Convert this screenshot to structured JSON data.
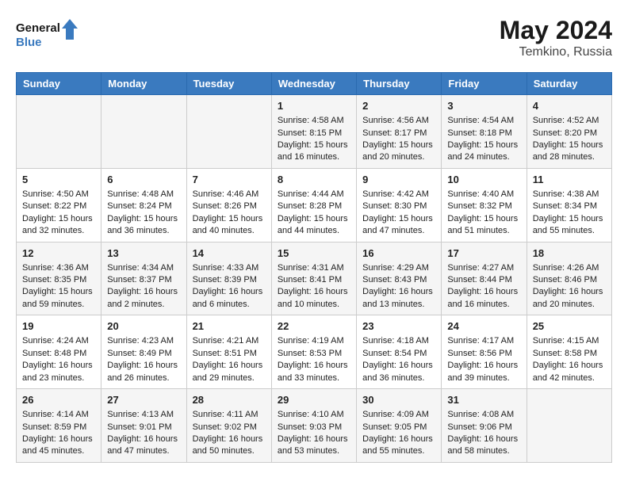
{
  "header": {
    "logo_line1": "General",
    "logo_line2": "Blue",
    "month_year": "May 2024",
    "location": "Temkino, Russia"
  },
  "days_of_week": [
    "Sunday",
    "Monday",
    "Tuesday",
    "Wednesday",
    "Thursday",
    "Friday",
    "Saturday"
  ],
  "weeks": [
    [
      {
        "day": "",
        "content": ""
      },
      {
        "day": "",
        "content": ""
      },
      {
        "day": "",
        "content": ""
      },
      {
        "day": "1",
        "content": "Sunrise: 4:58 AM\nSunset: 8:15 PM\nDaylight: 15 hours\nand 16 minutes."
      },
      {
        "day": "2",
        "content": "Sunrise: 4:56 AM\nSunset: 8:17 PM\nDaylight: 15 hours\nand 20 minutes."
      },
      {
        "day": "3",
        "content": "Sunrise: 4:54 AM\nSunset: 8:18 PM\nDaylight: 15 hours\nand 24 minutes."
      },
      {
        "day": "4",
        "content": "Sunrise: 4:52 AM\nSunset: 8:20 PM\nDaylight: 15 hours\nand 28 minutes."
      }
    ],
    [
      {
        "day": "5",
        "content": "Sunrise: 4:50 AM\nSunset: 8:22 PM\nDaylight: 15 hours\nand 32 minutes."
      },
      {
        "day": "6",
        "content": "Sunrise: 4:48 AM\nSunset: 8:24 PM\nDaylight: 15 hours\nand 36 minutes."
      },
      {
        "day": "7",
        "content": "Sunrise: 4:46 AM\nSunset: 8:26 PM\nDaylight: 15 hours\nand 40 minutes."
      },
      {
        "day": "8",
        "content": "Sunrise: 4:44 AM\nSunset: 8:28 PM\nDaylight: 15 hours\nand 44 minutes."
      },
      {
        "day": "9",
        "content": "Sunrise: 4:42 AM\nSunset: 8:30 PM\nDaylight: 15 hours\nand 47 minutes."
      },
      {
        "day": "10",
        "content": "Sunrise: 4:40 AM\nSunset: 8:32 PM\nDaylight: 15 hours\nand 51 minutes."
      },
      {
        "day": "11",
        "content": "Sunrise: 4:38 AM\nSunset: 8:34 PM\nDaylight: 15 hours\nand 55 minutes."
      }
    ],
    [
      {
        "day": "12",
        "content": "Sunrise: 4:36 AM\nSunset: 8:35 PM\nDaylight: 15 hours\nand 59 minutes."
      },
      {
        "day": "13",
        "content": "Sunrise: 4:34 AM\nSunset: 8:37 PM\nDaylight: 16 hours\nand 2 minutes."
      },
      {
        "day": "14",
        "content": "Sunrise: 4:33 AM\nSunset: 8:39 PM\nDaylight: 16 hours\nand 6 minutes."
      },
      {
        "day": "15",
        "content": "Sunrise: 4:31 AM\nSunset: 8:41 PM\nDaylight: 16 hours\nand 10 minutes."
      },
      {
        "day": "16",
        "content": "Sunrise: 4:29 AM\nSunset: 8:43 PM\nDaylight: 16 hours\nand 13 minutes."
      },
      {
        "day": "17",
        "content": "Sunrise: 4:27 AM\nSunset: 8:44 PM\nDaylight: 16 hours\nand 16 minutes."
      },
      {
        "day": "18",
        "content": "Sunrise: 4:26 AM\nSunset: 8:46 PM\nDaylight: 16 hours\nand 20 minutes."
      }
    ],
    [
      {
        "day": "19",
        "content": "Sunrise: 4:24 AM\nSunset: 8:48 PM\nDaylight: 16 hours\nand 23 minutes."
      },
      {
        "day": "20",
        "content": "Sunrise: 4:23 AM\nSunset: 8:49 PM\nDaylight: 16 hours\nand 26 minutes."
      },
      {
        "day": "21",
        "content": "Sunrise: 4:21 AM\nSunset: 8:51 PM\nDaylight: 16 hours\nand 29 minutes."
      },
      {
        "day": "22",
        "content": "Sunrise: 4:19 AM\nSunset: 8:53 PM\nDaylight: 16 hours\nand 33 minutes."
      },
      {
        "day": "23",
        "content": "Sunrise: 4:18 AM\nSunset: 8:54 PM\nDaylight: 16 hours\nand 36 minutes."
      },
      {
        "day": "24",
        "content": "Sunrise: 4:17 AM\nSunset: 8:56 PM\nDaylight: 16 hours\nand 39 minutes."
      },
      {
        "day": "25",
        "content": "Sunrise: 4:15 AM\nSunset: 8:58 PM\nDaylight: 16 hours\nand 42 minutes."
      }
    ],
    [
      {
        "day": "26",
        "content": "Sunrise: 4:14 AM\nSunset: 8:59 PM\nDaylight: 16 hours\nand 45 minutes."
      },
      {
        "day": "27",
        "content": "Sunrise: 4:13 AM\nSunset: 9:01 PM\nDaylight: 16 hours\nand 47 minutes."
      },
      {
        "day": "28",
        "content": "Sunrise: 4:11 AM\nSunset: 9:02 PM\nDaylight: 16 hours\nand 50 minutes."
      },
      {
        "day": "29",
        "content": "Sunrise: 4:10 AM\nSunset: 9:03 PM\nDaylight: 16 hours\nand 53 minutes."
      },
      {
        "day": "30",
        "content": "Sunrise: 4:09 AM\nSunset: 9:05 PM\nDaylight: 16 hours\nand 55 minutes."
      },
      {
        "day": "31",
        "content": "Sunrise: 4:08 AM\nSunset: 9:06 PM\nDaylight: 16 hours\nand 58 minutes."
      },
      {
        "day": "",
        "content": ""
      }
    ]
  ]
}
